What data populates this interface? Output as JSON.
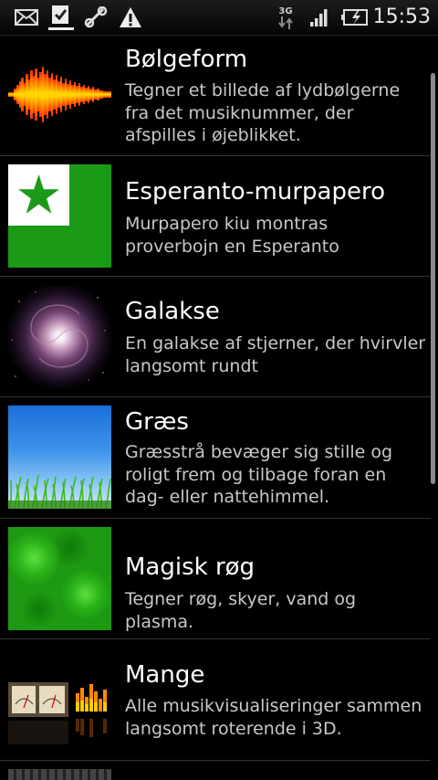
{
  "status_bar": {
    "time": "15:53",
    "network_type": "3G",
    "icons": [
      "envelope-icon",
      "download-done-icon",
      "usb-debug-icon",
      "warning-icon",
      "signal-icon",
      "battery-charging-icon"
    ]
  },
  "wallpapers": [
    {
      "title": "Bølgeform",
      "description": "Tegner et billede af lydbølgerne fra det musiknummer, der afspilles i øjeblikket.",
      "thumbnail": "waveform-thumbnail"
    },
    {
      "title": "Esperanto-murpapero",
      "description": "Murpapero kiu montras proverbojn en Esperanto",
      "thumbnail": "esperanto-flag-thumbnail"
    },
    {
      "title": "Galakse",
      "description": "En galakse af stjerner, der hvirvler langsomt rundt",
      "thumbnail": "galaxy-thumbnail"
    },
    {
      "title": "Græs",
      "description": "Græsstrå bevæger sig stille og roligt frem og tilbage foran en dag- eller nattehimmel.",
      "thumbnail": "grass-thumbnail"
    },
    {
      "title": "Magisk røg",
      "description": "Tegner røg, skyer, vand og plasma.",
      "thumbnail": "magic-smoke-thumbnail"
    },
    {
      "title": "Mange",
      "description": "Alle musikvisualiseringer sammen langsomt roterende i 3D.",
      "thumbnail": "many-visualizers-thumbnail"
    }
  ],
  "colors": {
    "background": "#000000",
    "divider": "#333333",
    "description_text": "#c8c8c8",
    "flag_green": "#1a9a17"
  }
}
